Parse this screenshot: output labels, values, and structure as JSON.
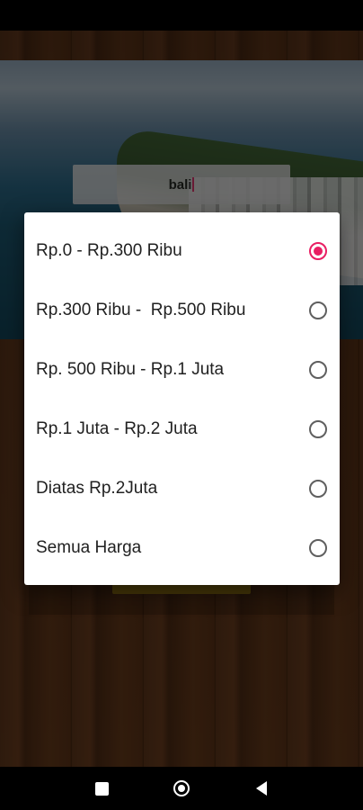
{
  "search": {
    "value": "bali"
  },
  "price_dialog": {
    "options": [
      {
        "label": "Rp.0 - Rp.300 Ribu",
        "selected": true
      },
      {
        "label": "Rp.300 Ribu -  Rp.500 Ribu",
        "selected": false
      },
      {
        "label": "Rp. 500 Ribu - Rp.1 Juta",
        "selected": false
      },
      {
        "label": "Rp.1 Juta - Rp.2 Juta",
        "selected": false
      },
      {
        "label": "Diatas Rp.2Juta",
        "selected": false
      },
      {
        "label": "Semua Harga",
        "selected": false
      }
    ]
  },
  "colors": {
    "accent": "#e91e63",
    "dialog_bg": "#ffffff",
    "button_gold": "#9b7a12"
  },
  "nav": {
    "icons": [
      "square-icon",
      "circle-home-icon",
      "triangle-back-icon"
    ]
  }
}
